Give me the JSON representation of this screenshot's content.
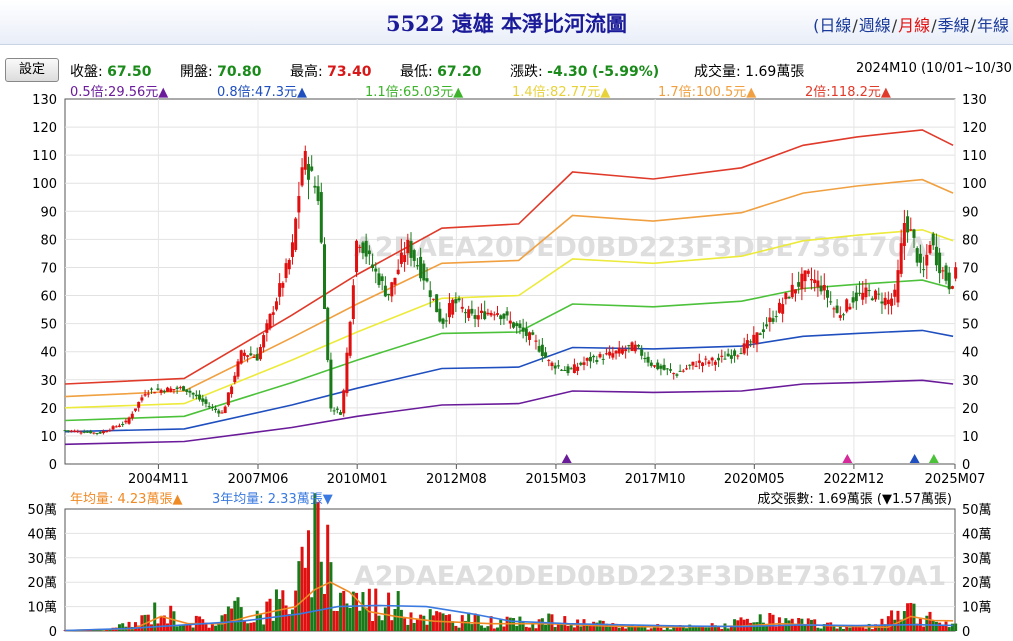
{
  "header": {
    "title": "5522 遠雄 本淨比河流圖",
    "open_paren": "(",
    "periods": [
      "日線",
      "週線",
      "月線",
      "季線",
      "年線"
    ],
    "selected_period": "月線"
  },
  "settings_button": "設定",
  "stats": {
    "close_label": "收盤:",
    "close": "67.50",
    "open_label": "開盤:",
    "open": "70.80",
    "high_label": "最高:",
    "high": "73.40",
    "low_label": "最低:",
    "low": "67.20",
    "change_label": "漲跌:",
    "change": "-4.30",
    "change_pct": "(-5.99%)",
    "volume_label": "成交量:",
    "volume": "1.69萬張",
    "period_range": "2024M10 (10/01~10/30)"
  },
  "colors": {
    "band_0_5": "#6a1b9a",
    "band_0_8": "#1f4fbf",
    "band_1_1": "#4cc13a",
    "band_1_4": "#ecea3a",
    "band_1_7": "#f0a040",
    "band_2": "#e03a2a",
    "up": "#e01010",
    "down": "#1a7a1a",
    "ma_year": "#f08a24",
    "ma_3y": "#3a7ae0"
  },
  "watermark": "A2DAEA20DED0BD223F3DBE736170A1",
  "chart_data": [
    {
      "type": "line",
      "title": "",
      "x_tick_labels": [
        "2004M11",
        "2007M06",
        "2010M01",
        "2012M08",
        "2015M03",
        "2017M10",
        "2020M05",
        "2022M12",
        "2025M07"
      ],
      "x_range": [
        "2002M05",
        "2025M07"
      ],
      "ylim": [
        0,
        130
      ],
      "y_ticks": [
        0,
        10,
        20,
        30,
        40,
        50,
        60,
        70,
        80,
        90,
        100,
        110,
        120,
        130
      ],
      "series": [
        {
          "name": "0.5倍:29.56元▲",
          "key": "band_0_5",
          "points": [
            [
              2002.4,
              7
            ],
            [
              2005.5,
              8
            ],
            [
              2008.3,
              13
            ],
            [
              2010.0,
              17
            ],
            [
              2012.2,
              21
            ],
            [
              2014.2,
              21.5
            ],
            [
              2015.6,
              26
            ],
            [
              2017.7,
              25.5
            ],
            [
              2020.0,
              26
            ],
            [
              2021.6,
              28.5
            ],
            [
              2023.0,
              29
            ],
            [
              2024.7,
              29.8
            ],
            [
              2025.5,
              28.5
            ]
          ]
        },
        {
          "name": "0.8倍:47.3元▲",
          "key": "band_0_8",
          "points": [
            [
              2002.4,
              11.5
            ],
            [
              2005.5,
              12.5
            ],
            [
              2008.3,
              21
            ],
            [
              2010.0,
              27
            ],
            [
              2012.2,
              34
            ],
            [
              2014.2,
              34.5
            ],
            [
              2015.6,
              41.5
            ],
            [
              2017.7,
              41
            ],
            [
              2020.0,
              42
            ],
            [
              2021.6,
              45.5
            ],
            [
              2023.0,
              46.5
            ],
            [
              2024.7,
              47.6
            ],
            [
              2025.5,
              45.5
            ]
          ]
        },
        {
          "name": "1.1倍:65.03元▲",
          "key": "band_1_1",
          "points": [
            [
              2002.4,
              15.5
            ],
            [
              2005.5,
              17
            ],
            [
              2008.3,
              29
            ],
            [
              2010.0,
              37
            ],
            [
              2012.2,
              46.5
            ],
            [
              2014.2,
              47
            ],
            [
              2015.6,
              57
            ],
            [
              2017.7,
              56
            ],
            [
              2020.0,
              58
            ],
            [
              2021.6,
              62.5
            ],
            [
              2023.0,
              64
            ],
            [
              2024.7,
              65.5
            ],
            [
              2025.5,
              62.5
            ]
          ]
        },
        {
          "name": "1.4倍:82.77元▲",
          "key": "band_1_4",
          "points": [
            [
              2002.4,
              20
            ],
            [
              2005.5,
              21.5
            ],
            [
              2008.3,
              37
            ],
            [
              2010.0,
              47
            ],
            [
              2012.2,
              59
            ],
            [
              2014.2,
              60
            ],
            [
              2015.6,
              73
            ],
            [
              2017.7,
              71.5
            ],
            [
              2020.0,
              74
            ],
            [
              2021.6,
              79.5
            ],
            [
              2023.0,
              81.5
            ],
            [
              2024.7,
              83.4
            ],
            [
              2025.5,
              79.5
            ]
          ]
        },
        {
          "name": "1.7倍:100.5元▲",
          "key": "band_1_7",
          "points": [
            [
              2002.4,
              24
            ],
            [
              2005.5,
              26
            ],
            [
              2008.3,
              45
            ],
            [
              2010.0,
              57
            ],
            [
              2012.2,
              71.5
            ],
            [
              2014.2,
              72.5
            ],
            [
              2015.6,
              88.5
            ],
            [
              2017.7,
              86.5
            ],
            [
              2020.0,
              89.5
            ],
            [
              2021.6,
              96.5
            ],
            [
              2023.0,
              99
            ],
            [
              2024.7,
              101.3
            ],
            [
              2025.5,
              96.5
            ]
          ]
        },
        {
          "name": "2倍:118.2元▲",
          "key": "band_2",
          "points": [
            [
              2002.4,
              28.5
            ],
            [
              2005.5,
              30.5
            ],
            [
              2008.3,
              53
            ],
            [
              2010.0,
              67.5
            ],
            [
              2012.2,
              84
            ],
            [
              2014.2,
              85.5
            ],
            [
              2015.6,
              104
            ],
            [
              2017.7,
              101.5
            ],
            [
              2020.0,
              105.5
            ],
            [
              2021.6,
              113.5
            ],
            [
              2023.0,
              116.5
            ],
            [
              2024.7,
              119
            ],
            [
              2025.5,
              113.5
            ]
          ]
        }
      ],
      "price_anchors": [
        [
          2002.4,
          12
        ],
        [
          2003.3,
          11
        ],
        [
          2004.0,
          15
        ],
        [
          2004.5,
          26
        ],
        [
          2005.5,
          27
        ],
        [
          2006.2,
          20
        ],
        [
          2006.5,
          18
        ],
        [
          2007.0,
          40
        ],
        [
          2007.4,
          38
        ],
        [
          2007.8,
          55
        ],
        [
          2008.3,
          75
        ],
        [
          2008.6,
          110
        ],
        [
          2009.0,
          95
        ],
        [
          2009.3,
          20
        ],
        [
          2009.6,
          18
        ],
        [
          2010.0,
          82
        ],
        [
          2010.4,
          70
        ],
        [
          2010.8,
          60
        ],
        [
          2011.3,
          78
        ],
        [
          2011.8,
          65
        ],
        [
          2012.2,
          50
        ],
        [
          2012.5,
          58
        ],
        [
          2013.0,
          52
        ],
        [
          2013.6,
          55
        ],
        [
          2014.2,
          48
        ],
        [
          2014.6,
          44
        ],
        [
          2015.0,
          36
        ],
        [
          2015.5,
          33
        ],
        [
          2016.0,
          37
        ],
        [
          2016.6,
          39
        ],
        [
          2017.2,
          42
        ],
        [
          2017.7,
          35
        ],
        [
          2018.3,
          32
        ],
        [
          2018.8,
          36
        ],
        [
          2019.4,
          37
        ],
        [
          2019.9,
          40
        ],
        [
          2020.3,
          44
        ],
        [
          2020.8,
          52
        ],
        [
          2021.3,
          62
        ],
        [
          2021.7,
          67
        ],
        [
          2022.1,
          63
        ],
        [
          2022.5,
          53
        ],
        [
          2022.9,
          59
        ],
        [
          2023.3,
          61
        ],
        [
          2023.8,
          58
        ],
        [
          2024.0,
          60
        ],
        [
          2024.25,
          88
        ],
        [
          2024.5,
          78
        ],
        [
          2024.7,
          66
        ],
        [
          2024.9,
          80
        ],
        [
          2025.1,
          72
        ],
        [
          2025.4,
          64
        ],
        [
          2025.55,
          67.5
        ]
      ],
      "markers": [
        {
          "x": 2015.45,
          "key": "band_0_5"
        },
        {
          "x": 2022.75,
          "key": "ma_pink"
        },
        {
          "x": 2024.5,
          "key": "band_0_8"
        },
        {
          "x": 2025.0,
          "key": "band_1_1"
        }
      ]
    },
    {
      "type": "bar",
      "title": "",
      "ylim": [
        0,
        50
      ],
      "y_tick_labels": [
        "0",
        "10萬",
        "20萬",
        "30萬",
        "40萬",
        "50萬"
      ],
      "y_ticks": [
        0,
        10,
        20,
        30,
        40,
        50
      ],
      "legend_left": [
        {
          "name": "年均量: 4.23萬張▲",
          "key": "ma_year"
        },
        {
          "name": "3年均量: 2.33萬張▼",
          "key": "ma_3y"
        }
      ],
      "legend_right": "成交張數: 1.69萬張 (▼1.57萬張)",
      "volume_anchors": [
        [
          2002.4,
          0.3
        ],
        [
          2003.5,
          0.5
        ],
        [
          2004.3,
          3
        ],
        [
          2004.8,
          8
        ],
        [
          2005.5,
          4
        ],
        [
          2006.3,
          3
        ],
        [
          2006.8,
          8
        ],
        [
          2007.3,
          6
        ],
        [
          2007.8,
          9
        ],
        [
          2008.3,
          14
        ],
        [
          2008.8,
          25
        ],
        [
          2009.1,
          40
        ],
        [
          2009.4,
          15
        ],
        [
          2010.0,
          12
        ],
        [
          2010.8,
          10
        ],
        [
          2011.5,
          7
        ],
        [
          2012.2,
          5
        ],
        [
          2013.0,
          4
        ],
        [
          2014.0,
          3
        ],
        [
          2015.0,
          4
        ],
        [
          2016.0,
          2.5
        ],
        [
          2017.0,
          2
        ],
        [
          2018.0,
          1.5
        ],
        [
          2019.0,
          1.5
        ],
        [
          2020.0,
          3
        ],
        [
          2020.8,
          4
        ],
        [
          2021.5,
          3
        ],
        [
          2022.5,
          2
        ],
        [
          2023.5,
          1.5
        ],
        [
          2024.25,
          12
        ],
        [
          2024.6,
          5
        ],
        [
          2025.0,
          4
        ],
        [
          2025.5,
          1.7
        ]
      ],
      "ma_year_points": [
        [
          2002.4,
          0.2
        ],
        [
          2004.2,
          1
        ],
        [
          2004.9,
          6
        ],
        [
          2005.6,
          3
        ],
        [
          2006.5,
          3
        ],
        [
          2007.2,
          6
        ],
        [
          2007.8,
          8
        ],
        [
          2008.4,
          10
        ],
        [
          2008.9,
          17
        ],
        [
          2009.3,
          20
        ],
        [
          2009.8,
          16
        ],
        [
          2010.3,
          8
        ],
        [
          2011.0,
          6
        ],
        [
          2012.0,
          4
        ],
        [
          2013.5,
          3
        ],
        [
          2015.0,
          3
        ],
        [
          2016.5,
          2
        ],
        [
          2018.0,
          1.6
        ],
        [
          2020.0,
          2
        ],
        [
          2021.0,
          3
        ],
        [
          2022.5,
          2
        ],
        [
          2023.8,
          1.5
        ],
        [
          2024.4,
          6
        ],
        [
          2025.0,
          4.3
        ],
        [
          2025.5,
          4.2
        ]
      ],
      "ma_3y_points": [
        [
          2002.4,
          0.2
        ],
        [
          2004.0,
          1
        ],
        [
          2005.5,
          2.5
        ],
        [
          2007.0,
          4
        ],
        [
          2008.5,
          7
        ],
        [
          2009.5,
          10
        ],
        [
          2010.5,
          10.5
        ],
        [
          2011.8,
          10
        ],
        [
          2013.0,
          7
        ],
        [
          2014.0,
          4
        ],
        [
          2015.5,
          3
        ],
        [
          2017.0,
          2.5
        ],
        [
          2018.5,
          2
        ],
        [
          2020.0,
          1.8
        ],
        [
          2021.5,
          2.5
        ],
        [
          2023.0,
          2.2
        ],
        [
          2024.5,
          2.6
        ],
        [
          2025.5,
          2.3
        ]
      ]
    }
  ]
}
